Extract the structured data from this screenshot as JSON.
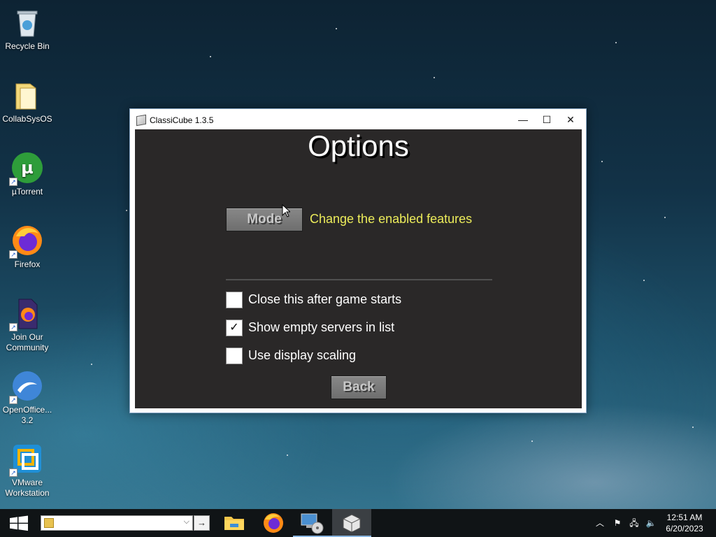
{
  "desktop": {
    "icons": [
      {
        "label": "Recycle Bin",
        "icon": "recycle-bin-icon"
      },
      {
        "label": "CollabSysOS",
        "icon": "folder-icon"
      },
      {
        "label": "µTorrent",
        "icon": "utorrent-icon"
      },
      {
        "label": "Firefox",
        "icon": "firefox-icon"
      },
      {
        "label": "Join Our Community",
        "icon": "firefox-file-icon"
      },
      {
        "label": "OpenOffice... 3.2",
        "icon": "openoffice-icon"
      },
      {
        "label": "VMware Workstation",
        "icon": "vmware-icon"
      }
    ]
  },
  "window": {
    "title": "ClassiCube 1.3.5",
    "controls": {
      "minimize": "—",
      "maximize": "☐",
      "close": "✕"
    },
    "heading": "Options",
    "mode_button": "Mode",
    "mode_description": "Change the enabled features",
    "checkboxes": [
      {
        "label": "Close this after game starts",
        "checked": false,
        "mark": ""
      },
      {
        "label": "Show empty servers in list",
        "checked": true,
        "mark": "✓"
      },
      {
        "label": "Use display scaling",
        "checked": false,
        "mark": ""
      }
    ],
    "back_button": "Back"
  },
  "taskbar": {
    "address_value": "",
    "go_glyph": "→",
    "dropdown_glyph": "⌵",
    "apps": [
      "file-explorer-icon",
      "firefox-icon",
      "media-player-icon",
      "classicube-icon"
    ],
    "tray": {
      "chevron": "︿",
      "flag": "⚑",
      "network": "🖧",
      "volume": "🔈"
    },
    "time": "12:51 AM",
    "date": "6/20/2023"
  },
  "colors": {
    "client_bg": "#2a2828",
    "mode_desc": "#ecec5a",
    "button_bg": "#7a7a7a"
  }
}
